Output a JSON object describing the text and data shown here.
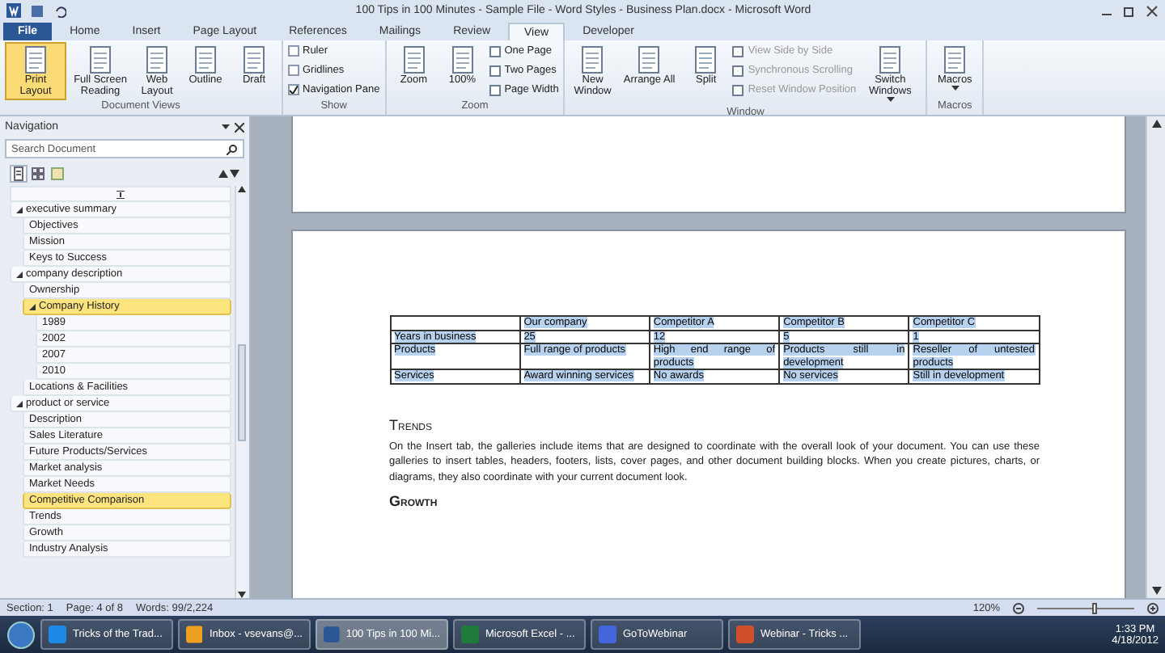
{
  "title_bar": {
    "title": "100 Tips in 100 Minutes - Sample File - Word Styles - Business Plan.docx - Microsoft Word"
  },
  "ribbon_tabs": [
    {
      "label": "File",
      "kind": "file",
      "selected": false
    },
    {
      "label": "Home",
      "kind": "tab",
      "selected": false
    },
    {
      "label": "Insert",
      "kind": "tab",
      "selected": false
    },
    {
      "label": "Page Layout",
      "kind": "tab",
      "selected": false
    },
    {
      "label": "References",
      "kind": "tab",
      "selected": false
    },
    {
      "label": "Mailings",
      "kind": "tab",
      "selected": false
    },
    {
      "label": "Review",
      "kind": "tab",
      "selected": false
    },
    {
      "label": "View",
      "kind": "tab",
      "selected": true
    },
    {
      "label": "Developer",
      "kind": "tab",
      "selected": false
    }
  ],
  "ribbon_groups": [
    {
      "label": "Document Views",
      "items": [
        {
          "kind": "large",
          "label": "Print Layout",
          "selected": true
        },
        {
          "kind": "large",
          "label": "Full Screen Reading",
          "selected": false
        },
        {
          "kind": "large",
          "label": "Web Layout",
          "selected": false
        },
        {
          "kind": "large",
          "label": "Outline",
          "selected": false
        },
        {
          "kind": "large",
          "label": "Draft",
          "selected": false
        }
      ]
    },
    {
      "label": "Show",
      "items": [
        {
          "kind": "check",
          "label": "Ruler",
          "checked": false
        },
        {
          "kind": "check",
          "label": "Gridlines",
          "checked": false
        },
        {
          "kind": "check",
          "label": "Navigation Pane",
          "checked": true
        }
      ]
    },
    {
      "label": "Zoom",
      "items": [
        {
          "kind": "large",
          "label": "Zoom",
          "selected": false
        },
        {
          "kind": "large",
          "label": "100%",
          "selected": false
        },
        {
          "kind": "small",
          "label": "One Page",
          "disabled": false
        },
        {
          "kind": "small",
          "label": "Two Pages",
          "disabled": false
        },
        {
          "kind": "small",
          "label": "Page Width",
          "disabled": false
        }
      ]
    },
    {
      "label": "Window",
      "items": [
        {
          "kind": "large",
          "label": "New Window",
          "selected": false
        },
        {
          "kind": "large",
          "label": "Arrange All",
          "selected": false
        },
        {
          "kind": "large",
          "label": "Split",
          "selected": false
        },
        {
          "kind": "small",
          "label": "View Side by Side",
          "disabled": true
        },
        {
          "kind": "small",
          "label": "Synchronous Scrolling",
          "disabled": true
        },
        {
          "kind": "small",
          "label": "Reset Window Position",
          "disabled": true
        },
        {
          "kind": "large",
          "label": "Switch Windows",
          "selected": false,
          "dropdown": true
        }
      ]
    },
    {
      "label": "Macros",
      "items": [
        {
          "kind": "large",
          "label": "Macros",
          "selected": false,
          "dropdown": true
        }
      ]
    }
  ],
  "navigation": {
    "title": "Navigation",
    "search": {
      "placeholder": "Search Document"
    },
    "tabs": [
      {
        "kind": "headings",
        "selected": true
      },
      {
        "kind": "pages",
        "selected": false
      },
      {
        "kind": "results",
        "selected": false
      }
    ],
    "items": [
      {
        "label": "executive summary",
        "expanded": true,
        "selected": false,
        "children": [
          {
            "label": "Objectives",
            "selected": false
          },
          {
            "label": "Mission",
            "selected": false
          },
          {
            "label": "Keys to Success",
            "selected": false
          }
        ]
      },
      {
        "label": "company description",
        "expanded": true,
        "selected": false,
        "children": [
          {
            "label": "Ownership",
            "selected": false
          },
          {
            "label": "Company History",
            "expanded": true,
            "selected": true,
            "children": [
              {
                "label": "1989",
                "selected": false
              },
              {
                "label": "2002",
                "selected": false
              },
              {
                "label": "2007",
                "selected": false
              },
              {
                "label": "2010",
                "selected": false
              }
            ]
          },
          {
            "label": "Locations & Facilities",
            "selected": false
          }
        ]
      },
      {
        "label": "product or service",
        "expanded": true,
        "selected": false,
        "children": [
          {
            "label": "Description",
            "selected": false
          },
          {
            "label": "Sales Literature",
            "selected": false
          },
          {
            "label": "Future Products/Services",
            "selected": false
          },
          {
            "label": "Market analysis",
            "selected": false
          },
          {
            "label": "Market Needs",
            "selected": false
          },
          {
            "label": "Competitive Comparison",
            "selected": true
          },
          {
            "label": "Trends",
            "selected": false
          },
          {
            "label": "Growth",
            "selected": false
          },
          {
            "label": "Industry Analysis",
            "selected": false
          }
        ]
      }
    ]
  },
  "document": {
    "table": {
      "selected": true,
      "columns": [
        "Our company",
        "Competitor A",
        "Competitor B",
        "Competitor C"
      ],
      "rows": [
        {
          "label": "Years in business",
          "cells": [
            "25",
            "12",
            "5",
            "1"
          ]
        },
        {
          "label": "Products",
          "cells": [
            "Full range of products",
            "High end range of products",
            "Products still in development",
            "Reseller of untested products"
          ]
        },
        {
          "label": "Services",
          "cells": [
            "Award winning services",
            "No awards",
            "No services",
            "Still in development"
          ]
        }
      ]
    },
    "heading": "Trends",
    "paragraph": "On the Insert tab, the galleries include items that are designed to coordinate with the overall look of your document. You can use these galleries to insert tables, headers, footers, lists, cover pages, and other document building blocks. When you create pictures, charts, or diagrams, they also coordinate with your current document look.",
    "next_heading": "Growth"
  },
  "status_bar": {
    "section": "Section: 1",
    "page": "Page: 4 of 8",
    "words": "Words: 99/2,224",
    "zoom": "120%",
    "zoom_slider": {
      "level": 0.6
    }
  },
  "taskbar": {
    "items": [
      {
        "kind": "ie",
        "label": "Tricks of the Trad...",
        "selected": false
      },
      {
        "kind": "outlook",
        "label": "Inbox - vsevans@...",
        "selected": false
      },
      {
        "kind": "word",
        "label": "100 Tips in 100 Mi...",
        "selected": true
      },
      {
        "kind": "excel",
        "label": "Microsoft Excel - ...",
        "selected": false
      },
      {
        "kind": "webinar",
        "label": "GoToWebinar",
        "selected": false
      },
      {
        "kind": "powerpoint",
        "label": "Webinar - Tricks ...",
        "selected": false
      }
    ],
    "time": "1:33 PM",
    "date": "4/18/2012"
  }
}
